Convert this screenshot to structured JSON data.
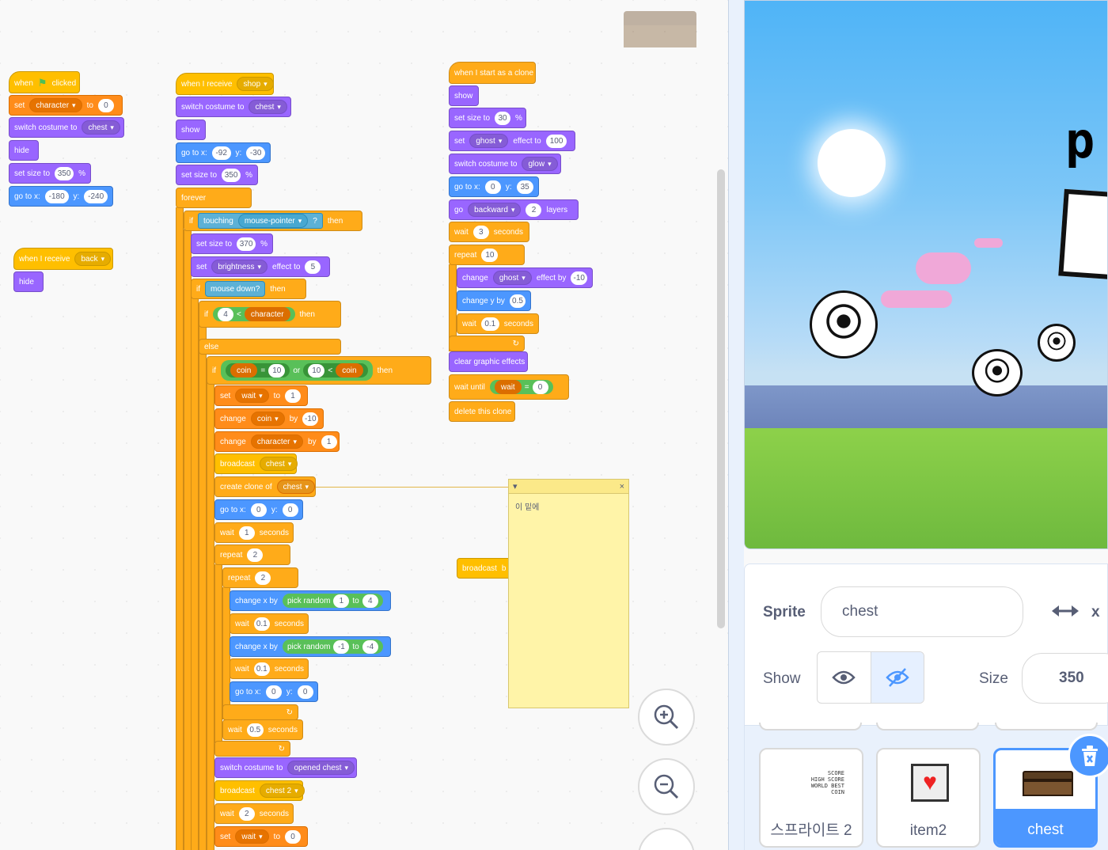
{
  "workspace": {
    "flag_script": {
      "when": "when",
      "clicked": "clicked",
      "set": "set",
      "var": "character",
      "to": "to",
      "val": "0",
      "switch": "switch costume to",
      "costume": "chest",
      "hide": "hide",
      "size": "set size to",
      "size_val": "350",
      "pct": "%",
      "goto": "go to x:",
      "x": "-180",
      "y_lbl": "y:",
      "y": "-240"
    },
    "back_script": {
      "when": "when I receive",
      "msg": "back",
      "hide": "hide"
    },
    "shop_script": {
      "when": "when I receive",
      "msg": "shop",
      "switch": "switch costume to",
      "costume": "chest",
      "show": "show",
      "goto": "go to x:",
      "x": "-92",
      "y_lbl": "y:",
      "y": "-30",
      "size": "set size to",
      "size_val": "350",
      "pct": "%",
      "forever": "forever",
      "if": "if",
      "touching": "touching",
      "touch_target": "mouse-pointer",
      "q": "?",
      "then": "then",
      "size2_val": "370",
      "set": "set",
      "effect": "brightness",
      "effect_to": "effect to",
      "effect_val": "5",
      "mouse_down": "mouse down?",
      "lt": "<",
      "four": "4",
      "character": "character",
      "else": "else",
      "coin": "coin",
      "eq": "=",
      "ten": "10",
      "or": "or",
      "wait_var": "wait",
      "to": "to",
      "one": "1",
      "change": "change",
      "by": "by",
      "neg10": "-10",
      "broadcast": "broadcast",
      "chest": "chest",
      "clone_of": "create clone of",
      "zero": "0",
      "wait": "wait",
      "seconds": "seconds",
      "repeat": "repeat",
      "two": "2",
      "change_x": "change x by",
      "pick": "pick random",
      "to_lbl": "to",
      "r1a": "1",
      "r1b": "4",
      "r2a": "-1",
      "r2b": "-4",
      "p1": "0.1",
      "p5": "0.5",
      "opened": "opened chest",
      "chest2": "chest 2",
      "loop_icon": "↻"
    },
    "clone_script": {
      "when": "when I start as a clone",
      "show": "show",
      "size": "set size to",
      "size_val": "30",
      "pct": "%",
      "set": "set",
      "effect": "ghost",
      "effect_to": "effect to",
      "effect_val": "100",
      "switch": "switch costume to",
      "costume": "glow",
      "goto": "go to x:",
      "x": "0",
      "y_lbl": "y:",
      "y": "35",
      "go": "go",
      "dir": "backward",
      "layers": "layers",
      "layers_val": "2",
      "wait": "wait",
      "wait_val": "3",
      "seconds": "seconds",
      "repeat": "repeat",
      "repeat_val": "10",
      "change": "change",
      "effect_by": "effect by",
      "by_val": "-10",
      "change_y": "change y by",
      "y_by": "0.5",
      "wait2": "0.1",
      "clear": "clear graphic effects",
      "wait_until": "wait until",
      "var": "wait",
      "eq": "=",
      "zero": "0",
      "delete": "delete this clone",
      "loop_icon": "↻"
    },
    "stray_broadcast": {
      "label": "broadcast",
      "val": "b"
    },
    "note": {
      "text": "이 밑에",
      "collapse": "▾",
      "close": "×"
    }
  },
  "stage": {
    "text1": "p"
  },
  "sprite_info": {
    "sprite_label": "Sprite",
    "sprite_name": "chest",
    "x_label": "x",
    "show_label": "Show",
    "size_label": "Size",
    "size_val": "350"
  },
  "sprites": [
    {
      "name": "스프라이트 2",
      "thumb": "SCORE\nHIGH SCORE\nWORLD BEST\nCOIN"
    },
    {
      "name": "item2"
    },
    {
      "name": "chest",
      "selected": true
    }
  ],
  "colors": {
    "events": "#ffbf00",
    "control": "#ffab19",
    "variables": "#ff8c1a",
    "looks": "#9966ff",
    "motion": "#4c97ff",
    "sensing": "#5cb1d6",
    "operators": "#59c059",
    "accent": "#4c97ff"
  }
}
